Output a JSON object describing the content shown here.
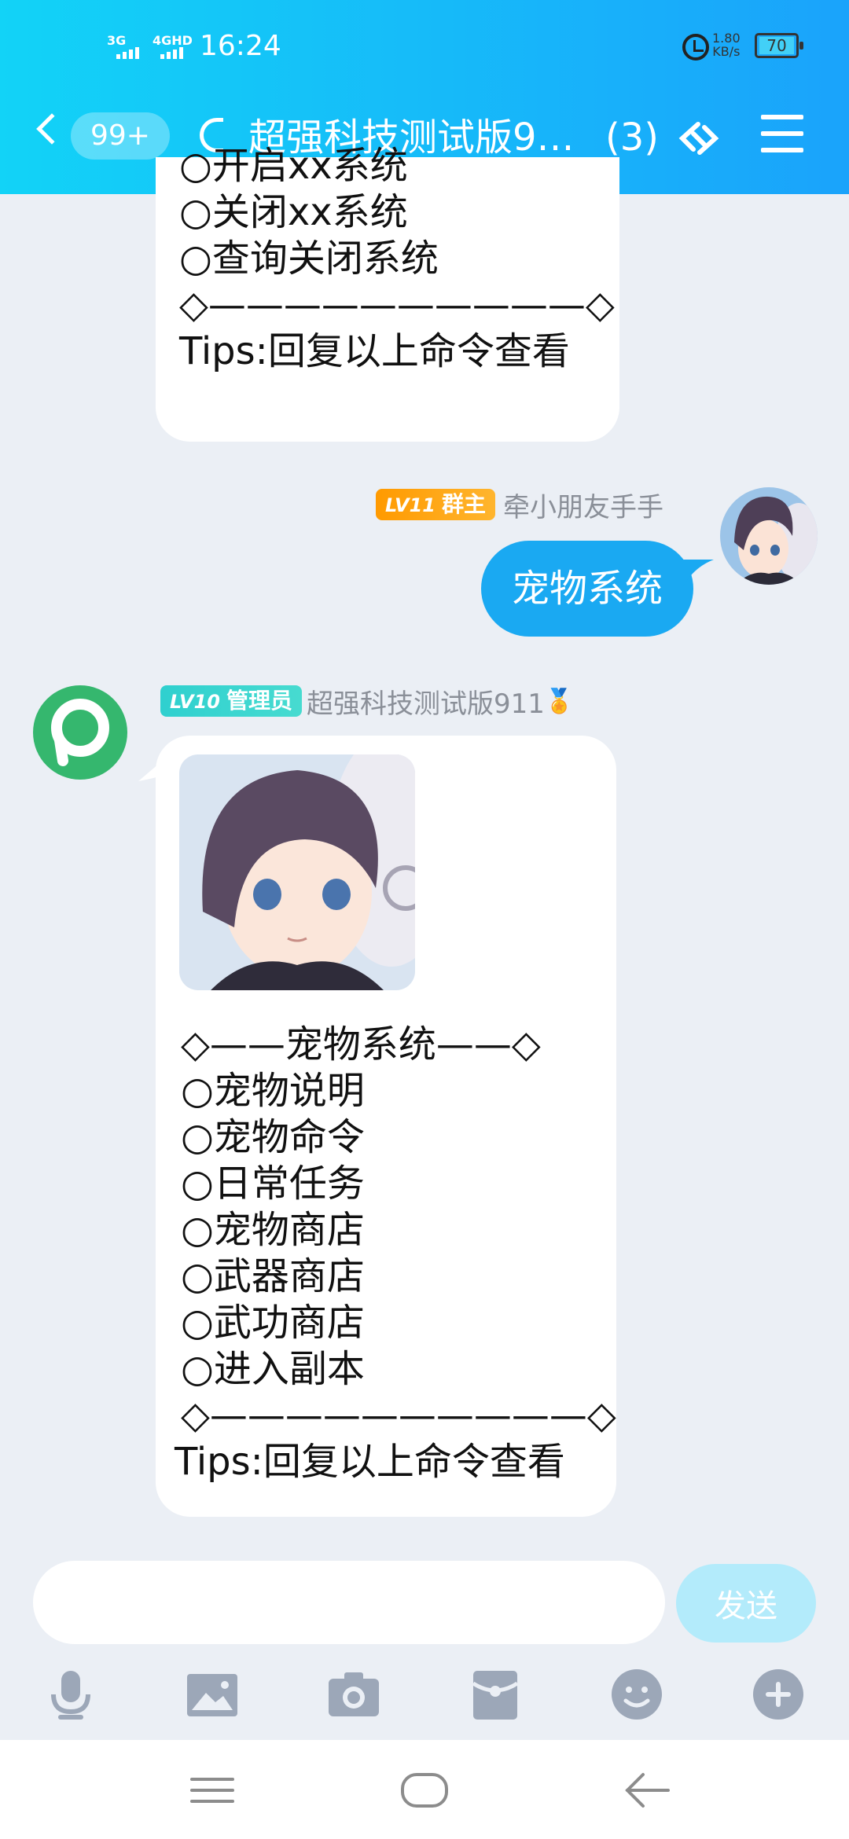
{
  "status_bar": {
    "signal1": "3G",
    "signal2": "4GHD",
    "time": "16:24",
    "speed_value": "1.80",
    "speed_unit": "KB/s",
    "battery": "70"
  },
  "header": {
    "unread_count": "99+",
    "title": "超强科技测试版9…",
    "member_count": "(3)"
  },
  "messages": {
    "prev_bot_lines": [
      "○开启xx系统",
      "○关闭xx系统",
      "○查询关闭系统",
      "◇——————————◇",
      "Tips:回复以上命令查看"
    ],
    "user_msg": {
      "level": "LV11",
      "role": "群主",
      "nickname": "牵小朋友手手",
      "text": "宠物系统"
    },
    "bot_msg": {
      "level": "LV10",
      "role": "管理员",
      "nickname": "超强科技测试版911",
      "medal": "🏅",
      "lines": [
        "◇——宠物系统——◇",
        "○宠物说明",
        "○宠物命令",
        "○日常任务",
        "○宠物商店",
        "○武器商店",
        "○武功商店",
        "○进入副本",
        "◇——————————◇",
        "Tips:回复以上命令查看"
      ]
    }
  },
  "input": {
    "value": "",
    "send_label": "发送"
  },
  "colors": {
    "header_start": "#12d3f7",
    "header_end": "#1aa3fb",
    "bubble_blue": "#1aa9f2",
    "bot_avatar": "#35b76e",
    "background": "#ebeff5"
  },
  "icons": {
    "toolbar": [
      "microphone-icon",
      "image-icon",
      "camera-icon",
      "red-packet-icon",
      "emoji-icon",
      "plus-icon"
    ],
    "nav": [
      "recent-apps-icon",
      "home-icon",
      "back-icon"
    ]
  }
}
